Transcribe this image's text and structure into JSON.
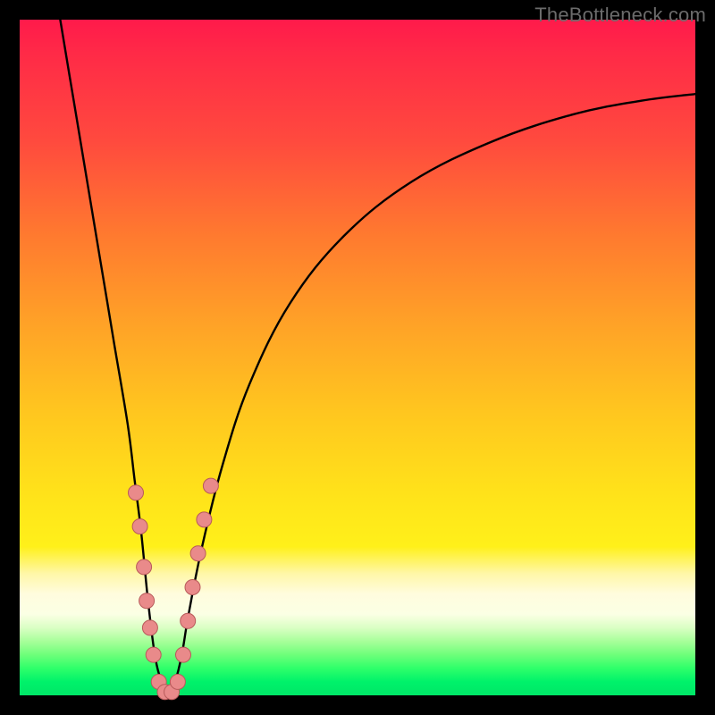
{
  "watermark": "TheBottleneck.com",
  "colors": {
    "marker_fill": "#e98a8a",
    "marker_stroke": "#b85a5a",
    "curve_stroke": "#000000",
    "gradient_top": "#ff1a4b",
    "gradient_bottom": "#00e667"
  },
  "chart_data": {
    "type": "line",
    "title": "",
    "xlabel": "",
    "ylabel": "",
    "xlim": [
      0,
      100
    ],
    "ylim": [
      0,
      100
    ],
    "grid": false,
    "legend": false,
    "note": "No visible axis ticks/labels in source image; x/y are normalized 0–100.",
    "series": [
      {
        "name": "bottleneck-curve",
        "x": [
          6,
          8,
          10,
          12,
          14,
          16,
          17,
          18,
          19,
          20,
          21,
          22,
          23,
          24,
          25,
          27,
          30,
          34,
          40,
          48,
          58,
          70,
          82,
          92,
          100
        ],
        "y": [
          100,
          88,
          76,
          64,
          52,
          40,
          32,
          24,
          14,
          6,
          2,
          0,
          2,
          6,
          12,
          22,
          34,
          46,
          58,
          68,
          76,
          82,
          86,
          88,
          89
        ]
      }
    ],
    "markers": [
      {
        "x": 17.2,
        "y": 30
      },
      {
        "x": 17.8,
        "y": 25
      },
      {
        "x": 18.4,
        "y": 19
      },
      {
        "x": 18.8,
        "y": 14
      },
      {
        "x": 19.3,
        "y": 10
      },
      {
        "x": 19.8,
        "y": 6
      },
      {
        "x": 20.6,
        "y": 2
      },
      {
        "x": 21.5,
        "y": 0.5
      },
      {
        "x": 22.5,
        "y": 0.5
      },
      {
        "x": 23.4,
        "y": 2
      },
      {
        "x": 24.2,
        "y": 6
      },
      {
        "x": 24.9,
        "y": 11
      },
      {
        "x": 25.6,
        "y": 16
      },
      {
        "x": 26.4,
        "y": 21
      },
      {
        "x": 27.3,
        "y": 26
      },
      {
        "x": 28.3,
        "y": 31
      }
    ]
  }
}
